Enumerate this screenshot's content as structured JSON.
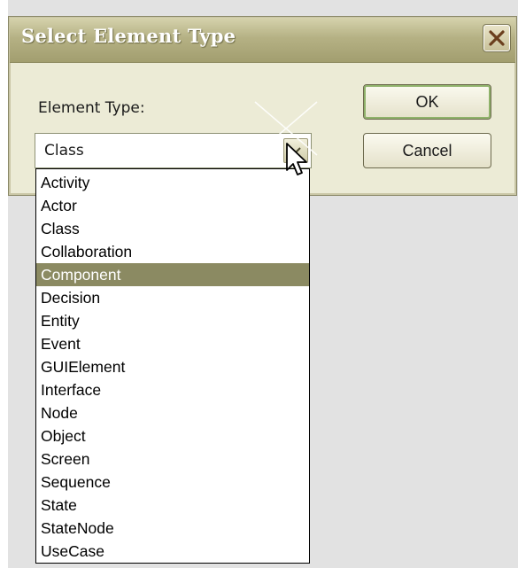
{
  "window": {
    "title": "Select Element Type"
  },
  "form": {
    "label": "Element Type:",
    "selected_value": "Class"
  },
  "buttons": {
    "ok_label": "OK",
    "cancel_label": "Cancel"
  },
  "dropdown": {
    "highlighted": "Component",
    "items": [
      "Activity",
      "Actor",
      "Class",
      "Collaboration",
      "Component",
      "Decision",
      "Entity",
      "Event",
      "GUIElement",
      "Interface",
      "Node",
      "Object",
      "Screen",
      "Sequence",
      "State",
      "StateNode",
      "UseCase"
    ]
  },
  "colors": {
    "dialog_bg": "#ecebd6",
    "titlebar": "#b5b184",
    "selection": "#8b8a62",
    "close_x": "#6b3f1e"
  },
  "icons": {
    "close": "close-icon",
    "dropdown": "chevron-down-icon",
    "cursor": "mouse-cursor-icon"
  }
}
